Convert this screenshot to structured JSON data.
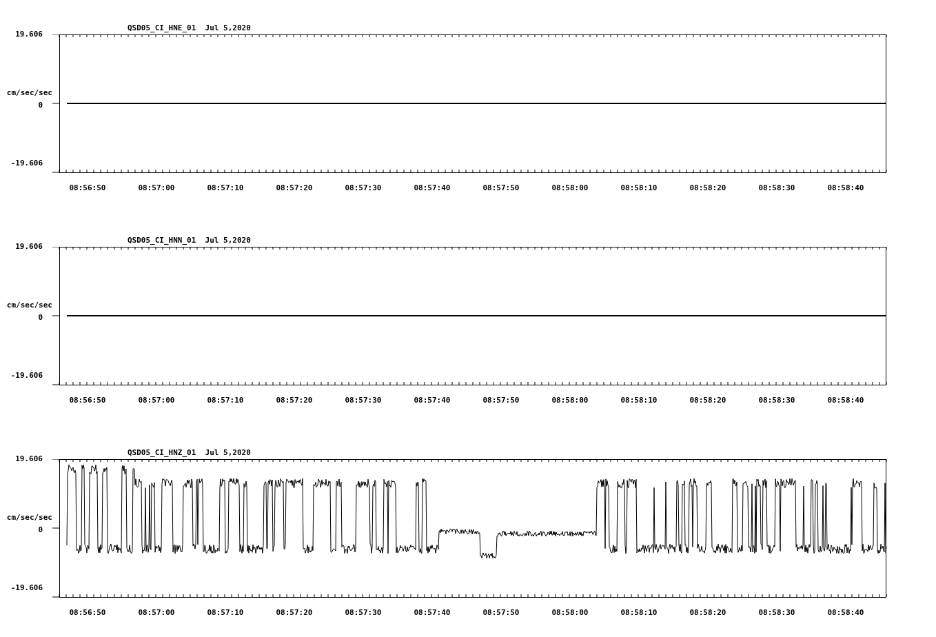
{
  "plots": [
    {
      "title": "QSD05_CI_HNE_01  Jul 5,2020",
      "unit": "cm/sec/sec",
      "y_ticks": [
        "19.606",
        "0",
        "-19.606"
      ],
      "x_ticks": [
        "08:56:50",
        "08:57:00",
        "08:57:10",
        "08:57:20",
        "08:57:30",
        "08:57:40",
        "08:57:50",
        "08:58:00",
        "08:58:10",
        "08:58:20",
        "08:58:30",
        "08:58:40"
      ],
      "trace": {
        "kind": "flat"
      }
    },
    {
      "title": "QSD05_CI_HNN_01  Jul 5,2020",
      "unit": "cm/sec/sec",
      "y_ticks": [
        "19.606",
        "0",
        "-19.606"
      ],
      "x_ticks": [
        "08:56:50",
        "08:57:00",
        "08:57:10",
        "08:57:20",
        "08:57:30",
        "08:57:40",
        "08:57:50",
        "08:58:00",
        "08:58:10",
        "08:58:20",
        "08:58:30",
        "08:58:40"
      ],
      "trace": {
        "kind": "flat"
      }
    },
    {
      "title": "QSD05_CI_HNZ_01  Jul 5,2020",
      "unit": "cm/sec/sec",
      "y_ticks": [
        "19.606",
        "0",
        "-19.606"
      ],
      "x_ticks": [
        "08:56:50",
        "08:57:00",
        "08:57:10",
        "08:57:20",
        "08:57:30",
        "08:57:40",
        "08:57:50",
        "08:58:00",
        "08:58:10",
        "08:58:20",
        "08:58:30",
        "08:58:40"
      ],
      "trace": {
        "kind": "wave"
      }
    }
  ]
}
